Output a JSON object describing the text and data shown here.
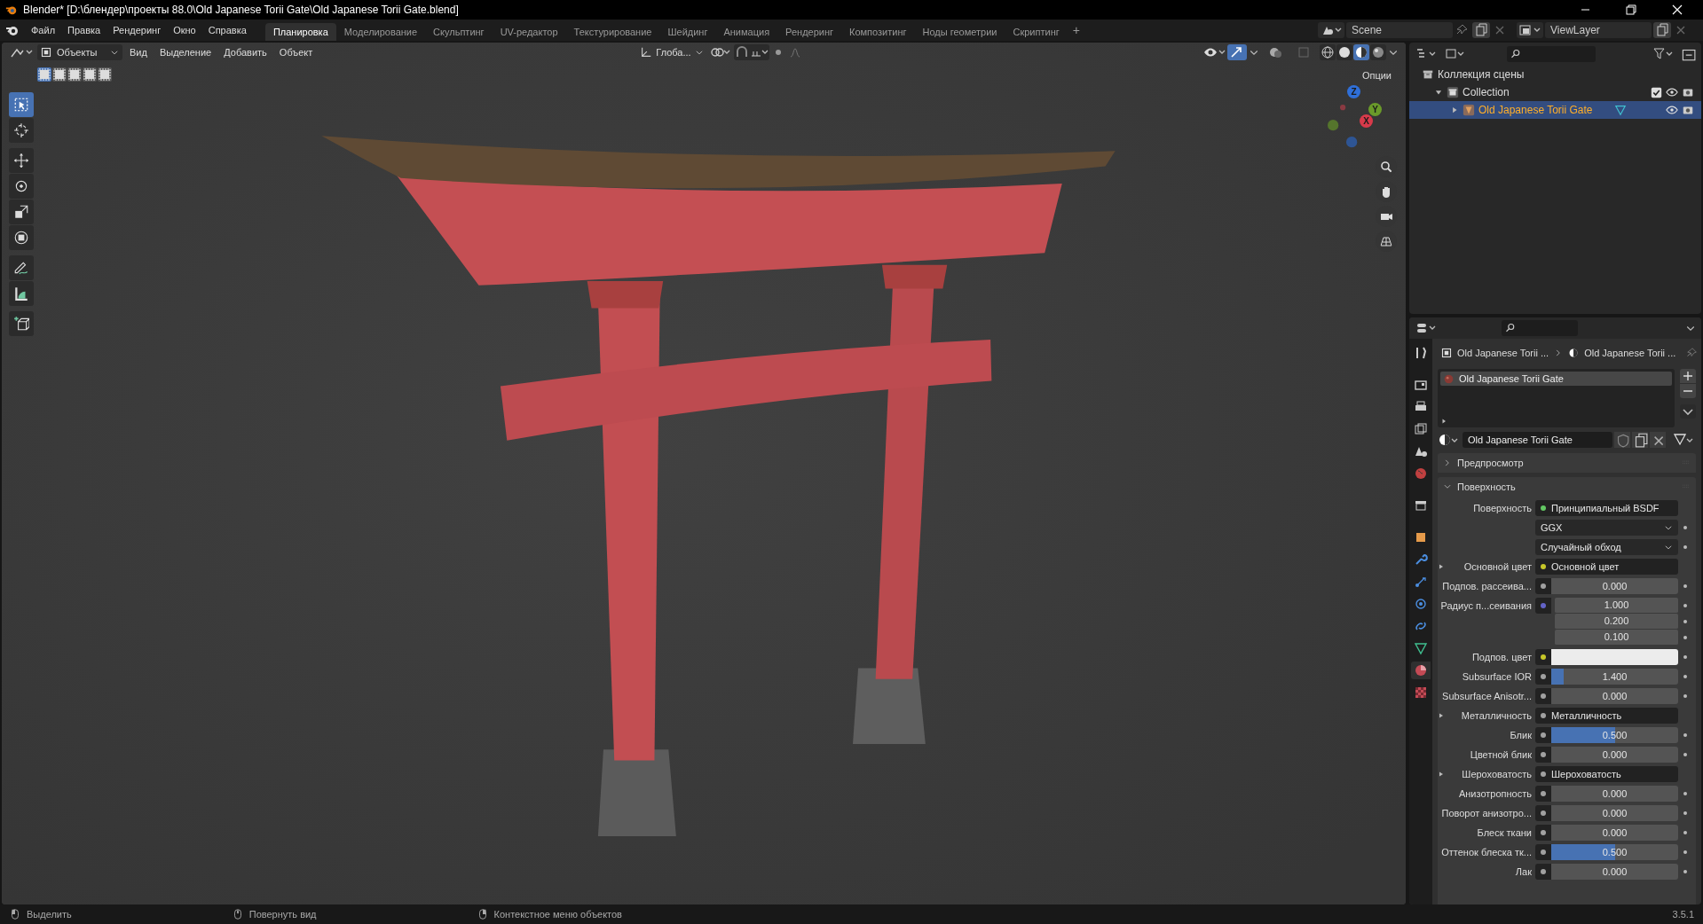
{
  "window": {
    "title": "Blender* [D:\\блендер\\проекты 88.0\\Old Japanese Torii Gate\\Old Japanese Torii Gate.blend]"
  },
  "menu": [
    "Файл",
    "Правка",
    "Рендеринг",
    "Окно",
    "Справка"
  ],
  "workspaces": [
    {
      "label": "Планировка",
      "selected": true
    },
    {
      "label": "Моделирование",
      "selected": false
    },
    {
      "label": "Скульптинг",
      "selected": false
    },
    {
      "label": "UV-редактор",
      "selected": false
    },
    {
      "label": "Текстурирование",
      "selected": false
    },
    {
      "label": "Шейдинг",
      "selected": false
    },
    {
      "label": "Анимация",
      "selected": false
    },
    {
      "label": "Рендеринг",
      "selected": false
    },
    {
      "label": "Композитинг",
      "selected": false
    },
    {
      "label": "Ноды геометрии",
      "selected": false
    },
    {
      "label": "Скриптинг",
      "selected": false
    }
  ],
  "add_workspace": "+",
  "scene": {
    "name": "Scene"
  },
  "view_layer": {
    "name": "ViewLayer"
  },
  "viewport": {
    "mode": "Объекты",
    "menus": [
      "Вид",
      "Выделение",
      "Добавить",
      "Объект"
    ],
    "orientation": "Глоба...",
    "options": "Опции",
    "select_modes": [
      {
        "selected": true
      },
      {
        "selected": false
      },
      {
        "selected": false
      },
      {
        "selected": false
      },
      {
        "selected": false
      }
    ],
    "shading": [
      {
        "kind": "wireframe",
        "selected": false
      },
      {
        "kind": "solid",
        "selected": false
      },
      {
        "kind": "material",
        "selected": true
      },
      {
        "kind": "rendered",
        "selected": false
      }
    ],
    "tools": [
      {
        "kind": "select_box",
        "selected": true
      },
      {
        "kind": "cursor",
        "selected": false
      },
      {
        "kind": "move",
        "selected": false
      },
      {
        "kind": "rotate",
        "selected": false
      },
      {
        "kind": "scale",
        "selected": false
      },
      {
        "kind": "transform",
        "selected": false
      },
      {
        "kind": "annotate",
        "selected": false
      },
      {
        "kind": "measure",
        "selected": false
      },
      {
        "kind": "add_cube",
        "selected": false
      }
    ],
    "gizmo_axes": [
      {
        "label": "Z",
        "color": "#2f6fd8"
      },
      {
        "label": "Y",
        "color": "#6a9a2a"
      },
      {
        "label": "X",
        "color": "#d83a4a"
      }
    ]
  },
  "outliner": {
    "tree": [
      {
        "label": "Коллекция сцены",
        "kind": "scene",
        "children": [
          {
            "label": "Collection",
            "kind": "collection",
            "expanded": true,
            "checked": true,
            "selected": false,
            "children": [
              {
                "label": "Old Japanese Torii Gate",
                "kind": "object",
                "expanded": false,
                "selected": true
              }
            ]
          }
        ]
      }
    ]
  },
  "properties": {
    "tabs": [
      {
        "kind": "tool",
        "selected": false
      },
      {
        "kind": "render",
        "selected": false
      },
      {
        "kind": "output",
        "selected": false
      },
      {
        "kind": "view_layer",
        "selected": false
      },
      {
        "kind": "scene",
        "selected": false
      },
      {
        "kind": "world",
        "selected": false
      },
      {
        "kind": "collection",
        "selected": false
      },
      {
        "kind": "object",
        "selected": false
      },
      {
        "kind": "modifier",
        "selected": false
      },
      {
        "kind": "particles",
        "selected": false
      },
      {
        "kind": "physics",
        "selected": false
      },
      {
        "kind": "constraints",
        "selected": false
      },
      {
        "kind": "data",
        "selected": false
      },
      {
        "kind": "material",
        "selected": true
      },
      {
        "kind": "texture",
        "selected": false
      }
    ],
    "breadcrumb": [
      "Old Japanese Torii ...",
      "Old Japanese Torii ..."
    ],
    "material_slots": [
      {
        "name": "Old Japanese Torii Gate",
        "selected": true
      }
    ],
    "material_name": "Old Japanese Torii Gate",
    "panels": [
      {
        "label": "Предпросмотр",
        "expanded": false
      },
      {
        "label": "Поверхность",
        "expanded": true
      }
    ],
    "rows": [
      {
        "kind": "link",
        "label": "Поверхность",
        "value": "Принципиальный BSDF",
        "color": "#63c763",
        "expandable": false
      },
      {
        "kind": "dropdown",
        "value": "GGX"
      },
      {
        "kind": "dropdown",
        "value": "Случайный обход"
      },
      {
        "kind": "link",
        "label": "Основной цвет",
        "value": "Основной цвет",
        "color": "#c7c729",
        "expandable": true
      },
      {
        "kind": "slider",
        "label": "Подпов. рассеива...",
        "value": "0.000",
        "color": "#a1a1a1"
      },
      {
        "kind": "vector",
        "label": "Радиус п...сеивания",
        "values": [
          "1.000",
          "0.200",
          "0.100"
        ],
        "color": "#6363c7"
      },
      {
        "kind": "color",
        "label": "Подпов. цвет",
        "color": "#c7c729"
      },
      {
        "kind": "slider",
        "label": "Subsurface IOR",
        "value": "1.400",
        "level": 0.1,
        "color": "#a1a1a1"
      },
      {
        "kind": "slider",
        "label": "Subsurface Anisotr...",
        "value": "0.000",
        "color": "#a1a1a1"
      },
      {
        "kind": "link",
        "label": "Металличность",
        "value": "Металличность",
        "color": "#a1a1a1",
        "expandable": true
      },
      {
        "kind": "slider",
        "label": "Блик",
        "value": "0.500",
        "level": 0.5,
        "color": "#a1a1a1"
      },
      {
        "kind": "slider",
        "label": "Цветной блик",
        "value": "0.000",
        "color": "#a1a1a1"
      },
      {
        "kind": "link",
        "label": "Шероховатость",
        "value": "Шероховатость",
        "color": "#a1a1a1",
        "expandable": true
      },
      {
        "kind": "slider",
        "label": "Анизотропность",
        "value": "0.000",
        "color": "#a1a1a1"
      },
      {
        "kind": "slider",
        "label": "Поворот анизотро...",
        "value": "0.000",
        "color": "#a1a1a1"
      },
      {
        "kind": "slider",
        "label": "Блеск ткани",
        "value": "0.000",
        "color": "#a1a1a1"
      },
      {
        "kind": "slider",
        "label": "Оттенок блеска тк...",
        "value": "0.500",
        "level": 0.5,
        "color": "#a1a1a1"
      },
      {
        "kind": "slider",
        "label": "Лак",
        "value": "0.000",
        "color": "#a1a1a1"
      }
    ]
  },
  "status_bar": {
    "items": [
      "Выделить",
      "Повернуть вид",
      "Контекстное меню объектов"
    ],
    "version": "3.5.1"
  }
}
